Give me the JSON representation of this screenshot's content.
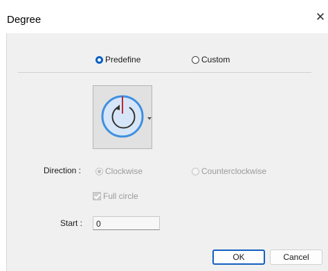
{
  "window": {
    "title": "Degree",
    "close_glyph": "✕"
  },
  "mode": {
    "predefine_label": "Predefine",
    "custom_label": "Custom",
    "selected": "Predefine"
  },
  "preview": {
    "icon": "circular-clockwise-arrow-icon",
    "dropdown_icon": "dropdown-arrow-icon",
    "colors": {
      "ring": "#3e8fe0",
      "fill": "#d6e6f8",
      "marker": "#c0262d",
      "arrow": "#333333"
    }
  },
  "direction": {
    "label": "Direction :",
    "clockwise_label": "Clockwise",
    "counterclockwise_label": "Counterclockwise",
    "selected": "Clockwise"
  },
  "full_circle": {
    "label": "Full circle",
    "checked": true
  },
  "start": {
    "label": "Start :",
    "value": "0"
  },
  "buttons": {
    "ok": "OK",
    "cancel": "Cancel"
  },
  "colors": {
    "accent": "#0a5fc4",
    "client_bg": "#f0f0f0"
  }
}
